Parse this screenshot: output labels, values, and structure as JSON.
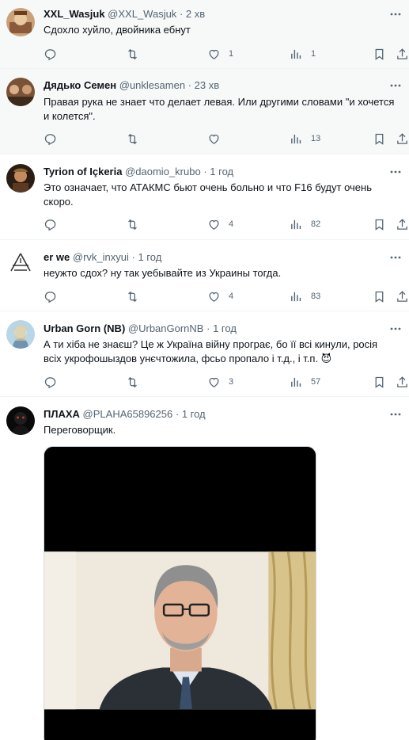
{
  "tweets": [
    {
      "name": "XXL_Wasjuk",
      "handle": "@XXL_Wasjuk",
      "dot": "·",
      "time": "2 хв",
      "text": "Сдохло хуйло, двойника ебнут",
      "replies": "",
      "retweets": "",
      "likes": "1",
      "views": "1"
    },
    {
      "name": "Дядько Семен",
      "handle": "@unklesamen",
      "dot": "·",
      "time": "23 хв",
      "text": "Правая рука не знает что делает левая. Или другими словами \"и хочется и колется\".",
      "replies": "",
      "retweets": "",
      "likes": "",
      "views": "13"
    },
    {
      "name": "Tyrion of Içkeria",
      "handle": "@daomio_krubo",
      "dot": "·",
      "time": "1 год",
      "text": "Это означает, что АТАКМС бьют очень больно и что F16 будут очень скоро.",
      "replies": "",
      "retweets": "",
      "likes": "4",
      "views": "82"
    },
    {
      "name": "er we",
      "handle": "@rvk_inxyui",
      "dot": "·",
      "time": "1 год",
      "text": "неужто сдох? ну так уебывайте из Украины тогда.",
      "replies": "",
      "retweets": "",
      "likes": "4",
      "views": "83"
    },
    {
      "name": "Urban Gorn (NB)",
      "handle": "@UrbanGornNB",
      "dot": "·",
      "time": "1 год",
      "text": "А ти хіба не знаєш? Це ж Україна війну програє, бо її всі кинули, росія всіх укрофошыздов унєчтожила, фсьо пропало і т.д., і т.п. 😈",
      "replies": "",
      "retweets": "",
      "likes": "3",
      "views": "57"
    },
    {
      "name": "ПЛАХА",
      "handle": "@PLAHA65896256",
      "dot": "·",
      "time": "1 год",
      "text": "Переговорщик."
    }
  ],
  "icons": {
    "reply": "reply-icon",
    "retweet": "retweet-icon",
    "like": "heart-icon",
    "views": "views-icon",
    "bookmark": "bookmark-icon",
    "share": "share-icon",
    "more": "more-icon"
  },
  "colors": {
    "text": "#0f1419",
    "secondary": "#536471",
    "border": "#eff3f4",
    "highlight_bg": "#f7f9f9"
  }
}
